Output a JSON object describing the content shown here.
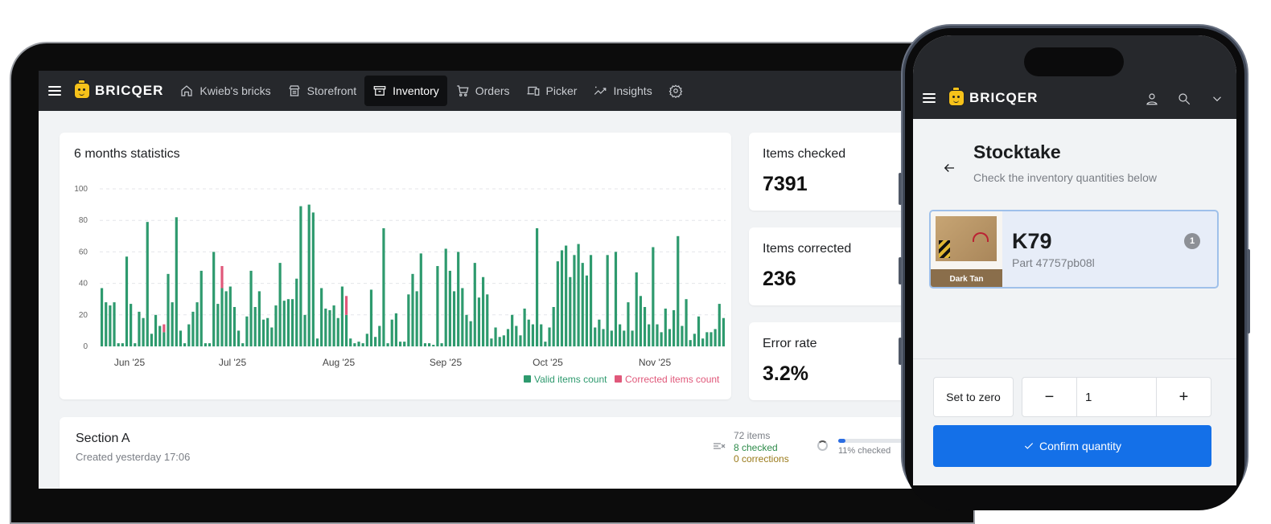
{
  "desktop": {
    "brand": "BRICQER",
    "nav": [
      {
        "label": "Kwieb's bricks",
        "icon": "home-icon",
        "active": false
      },
      {
        "label": "Storefront",
        "icon": "storefront-icon",
        "active": false
      },
      {
        "label": "Inventory",
        "icon": "inventory-icon",
        "active": true
      },
      {
        "label": "Orders",
        "icon": "cart-icon",
        "active": false
      },
      {
        "label": "Picker",
        "icon": "devices-icon",
        "active": false
      },
      {
        "label": "Insights",
        "icon": "insights-icon",
        "active": false
      }
    ],
    "settings_icon": "gear-icon",
    "stats_title": "6 months statistics",
    "kpis": [
      {
        "label": "Items checked",
        "value": "7391"
      },
      {
        "label": "Items corrected",
        "value": "236"
      },
      {
        "label": "Error rate",
        "value": "3.2%"
      }
    ],
    "section": {
      "title": "Section A",
      "created": "Created yesterday 17:06",
      "items": "72 items",
      "checked": "8 checked",
      "corrections": "0 corrections",
      "progress_fraction": 0.11,
      "progress_label": "11% checked"
    }
  },
  "chart_data": {
    "type": "bar",
    "title": "6 months statistics",
    "stacked": true,
    "ylim": [
      0,
      100
    ],
    "yticks": [
      "0",
      "20",
      "40",
      "60",
      "80",
      "100"
    ],
    "xticks": [
      "Jun '25",
      "Jul '25",
      "Aug '25",
      "Sep '25",
      "Oct '25",
      "Nov '25"
    ],
    "legend": [
      "Valid items count",
      "Corrected items count"
    ],
    "legend_position": "bottom-right",
    "colors": {
      "valid": "#2e9a6e",
      "corrected": "#e0587a"
    },
    "series": [
      {
        "name": "Valid items count",
        "values": [
          37,
          28,
          26,
          28,
          2,
          2,
          57,
          27,
          2,
          22,
          18,
          79,
          8,
          20,
          13,
          9,
          46,
          28,
          82,
          10,
          2,
          14,
          22,
          28,
          48,
          2,
          2,
          60,
          27,
          37,
          35,
          38,
          25,
          10,
          2,
          19,
          48,
          25,
          35,
          17,
          18,
          12,
          26,
          53,
          29,
          30,
          30,
          43,
          89,
          20,
          90,
          85,
          5,
          37,
          24,
          23,
          26,
          18,
          38,
          20,
          5,
          2,
          3,
          2,
          8,
          36,
          6,
          13,
          75,
          2,
          17,
          21,
          3,
          3,
          33,
          46,
          35,
          59,
          2,
          2,
          1,
          51,
          2,
          62,
          48,
          35,
          60,
          37,
          20,
          16,
          53,
          31,
          44,
          33,
          5,
          12,
          6,
          7,
          11,
          20,
          13,
          7,
          24,
          17,
          14,
          75,
          14,
          3,
          12,
          25,
          54,
          61,
          64,
          44,
          58,
          65,
          53,
          45,
          58,
          12,
          17,
          11,
          58,
          10,
          60,
          14,
          10,
          28,
          10,
          47,
          32,
          25,
          14,
          63,
          14,
          9,
          24,
          11,
          23,
          70,
          13,
          30,
          4,
          8,
          19,
          5,
          9,
          9,
          11,
          27,
          18
        ]
      },
      {
        "name": "Corrected items count",
        "values": [
          0,
          0,
          0,
          0,
          0,
          0,
          0,
          0,
          0,
          0,
          0,
          0,
          0,
          0,
          0,
          5,
          0,
          0,
          0,
          0,
          0,
          0,
          0,
          0,
          0,
          0,
          0,
          0,
          0,
          14,
          0,
          0,
          0,
          0,
          0,
          0,
          0,
          0,
          0,
          0,
          0,
          0,
          0,
          0,
          0,
          0,
          0,
          0,
          0,
          0,
          0,
          0,
          0,
          0,
          0,
          0,
          0,
          0,
          0,
          12,
          0,
          0,
          0,
          0,
          0,
          0,
          0,
          0,
          0,
          0,
          0,
          0,
          0,
          0,
          0,
          0,
          0,
          0,
          0,
          0,
          0,
          0,
          0,
          0,
          0,
          0,
          0,
          0,
          0,
          0,
          0,
          0,
          0,
          0,
          0,
          0,
          0,
          0,
          0,
          0,
          0,
          0,
          0,
          0,
          0,
          0,
          0,
          0,
          0,
          0,
          0,
          0,
          0,
          0,
          0,
          0,
          0,
          0,
          0,
          0,
          0,
          0,
          0,
          0,
          0,
          0,
          0,
          0,
          0,
          0,
          0,
          0,
          0,
          0,
          0,
          0,
          0,
          0,
          0,
          0,
          0,
          0,
          0,
          0,
          0,
          0,
          0,
          0,
          0,
          0,
          0
        ]
      }
    ]
  },
  "mobile": {
    "brand": "BRICQER",
    "title": "Stocktake",
    "subtitle": "Check the inventory quantities below",
    "item": {
      "code": "K79",
      "part": "Part 47757pb08l",
      "color_name": "Dark Tan",
      "badge": "1"
    },
    "set_zero": "Set to zero",
    "minus": "−",
    "quantity": "1",
    "plus": "+",
    "confirm": "Confirm quantity"
  }
}
